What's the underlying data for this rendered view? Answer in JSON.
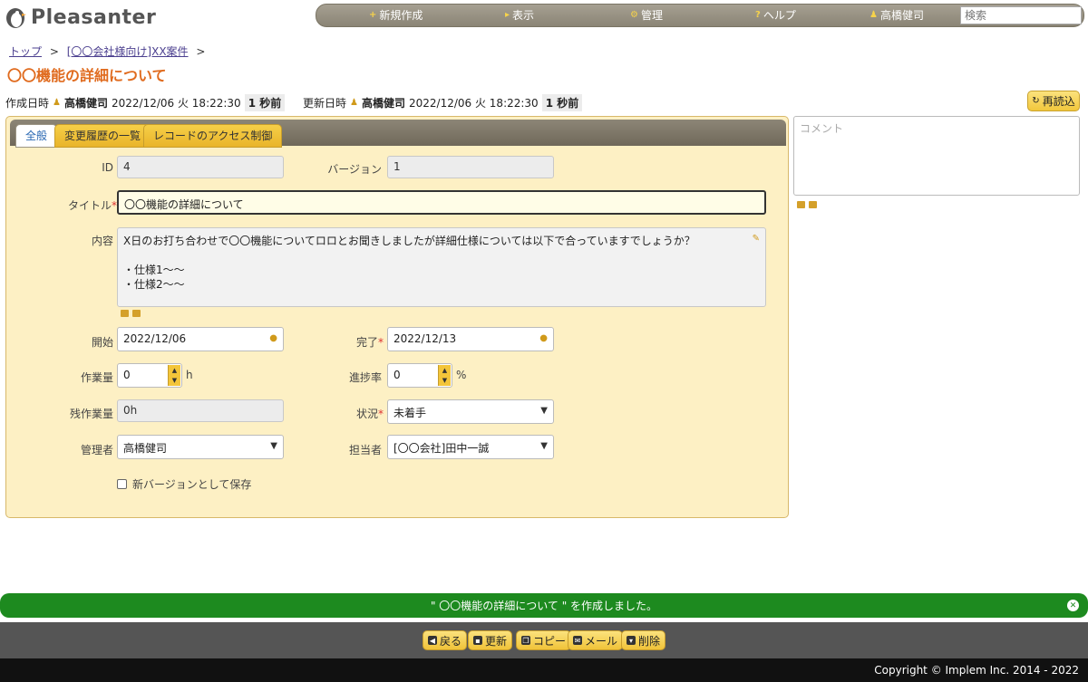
{
  "app": {
    "name": "Pleasanter"
  },
  "menu": {
    "new": "新規作成",
    "view": "表示",
    "manage": "管理",
    "help": "ヘルプ",
    "user": "高橋健司",
    "search_placeholder": "検索"
  },
  "breadcrumb": {
    "top": "トップ",
    "sep": ">",
    "item": "[〇〇会社様向け]XX案件"
  },
  "page_title": "〇〇機能の詳細について",
  "meta": {
    "created_label": "作成日時",
    "created_user": "高橋健司",
    "created_at": "2022/12/06 火 18:22:30",
    "created_ago": "1 秒前",
    "updated_label": "更新日時",
    "updated_user": "高橋健司",
    "updated_at": "2022/12/06 火 18:22:30",
    "updated_ago": "1 秒前"
  },
  "reload_label": "再読込",
  "tabs": [
    "全般",
    "変更履歴の一覧",
    "レコードのアクセス制御"
  ],
  "form": {
    "id_label": "ID",
    "id_value": "4",
    "version_label": "バージョン",
    "version_value": "1",
    "title_label": "タイトル",
    "title_value": "〇〇機能の詳細について",
    "content_label": "内容",
    "content_lines": [
      "X日のお打ち合わせで〇〇機能についてロロとお聞きしましたが詳細仕様については以下で合っていますでしょうか？",
      "",
      "・仕様1〜〜",
      "・仕様2〜〜"
    ],
    "start_label": "開始",
    "start_value": "2022/12/06",
    "end_label": "完了",
    "end_value": "2022/12/13",
    "work_label": "作業量",
    "work_value": "0",
    "work_unit": "h",
    "progress_label": "進捗率",
    "progress_value": "0",
    "progress_unit": "%",
    "remain_label": "残作業量",
    "remain_value": "0h",
    "status_label": "状況",
    "status_value": "未着手",
    "manager_label": "管理者",
    "manager_value": "高橋健司",
    "owner_label": "担当者",
    "owner_value": "[〇〇会社]田中一誠",
    "new_version_label": "新バージョンとして保存",
    "required_mark": "*"
  },
  "comment_placeholder": "コメント",
  "toast": "\" 〇〇機能の詳細について \" を作成しました。",
  "footer_buttons": {
    "back": "戻る",
    "update": "更新",
    "copy": "コピー",
    "mail": "メール",
    "delete": "削除"
  },
  "copyright": "Copyright © Implem Inc. 2014 - 2022",
  "colors": {
    "accent": "#f2c73c",
    "title": "#e06b1e",
    "toast": "#1d8a1f",
    "panel": "#fdf0c4"
  }
}
